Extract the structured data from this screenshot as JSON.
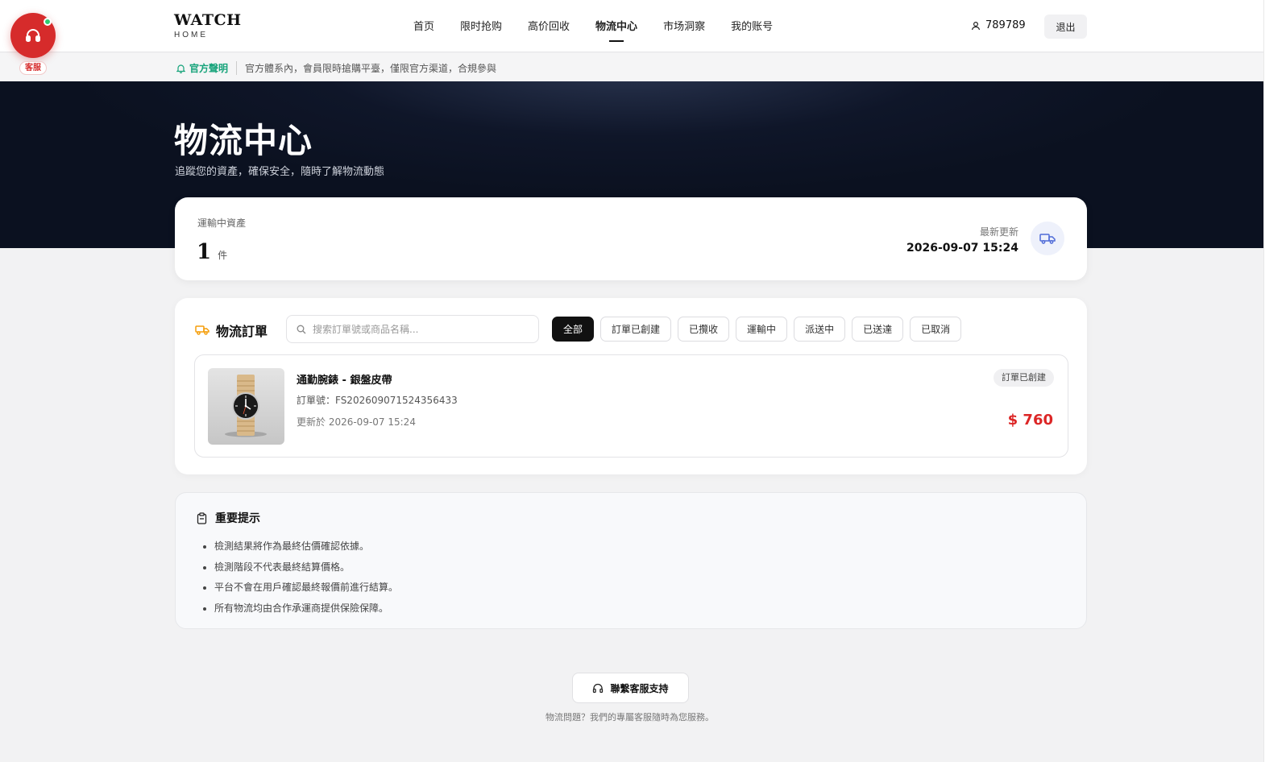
{
  "header": {
    "logo_main": "WATCH",
    "logo_sub": "HOME",
    "nav": [
      "首页",
      "限时抢购",
      "高价回收",
      "物流中心",
      "市场洞察",
      "我的账号"
    ],
    "username": "789789",
    "logout_label": "退出"
  },
  "notice": {
    "tag": "官方聲明",
    "text": "官方體系內，會員限時搶購平臺，僅限官方渠道，合規參與"
  },
  "support_fab": {
    "label": "客服",
    "accent": "#d62b2b"
  },
  "hero": {
    "title": "物流中心",
    "subtitle": "追蹤您的資產，確保安全，隨時了解物流動態"
  },
  "summary": {
    "in_transit_label": "運輸中資產",
    "count": "1",
    "unit": "件",
    "updated_label": "最新更新",
    "updated_time": "2026-09-07 15:24"
  },
  "orders": {
    "title": "物流訂單",
    "search_placeholder": "搜索訂單號或商品名稱...",
    "filters": [
      "全部",
      "訂單已創建",
      "已攬收",
      "運輸中",
      "派送中",
      "已送達",
      "已取消"
    ],
    "active_filter": "全部",
    "items": [
      {
        "name": "通勤腕錶 - 銀盤皮帶",
        "order_no": "訂單號：FS202609071524356433",
        "updated": "更新於 2026-09-07 15:24",
        "status": "訂單已創建",
        "price": "$ 760"
      }
    ]
  },
  "tips": {
    "title": "重要提示",
    "items": [
      "檢測結果將作為最終估價確認依據。",
      "檢測階段不代表最終結算價格。",
      "平台不會在用戶確認最終報價前進行結算。",
      "所有物流均由合作承運商提供保險保障。"
    ]
  },
  "footer": {
    "support_label": "聯繫客服支持",
    "note": "物流問題？我們的專屬客服隨時為您服務。"
  },
  "colors": {
    "accent_green": "#16a37a",
    "price_red": "#dc2626",
    "truck_orange": "#f59e0b",
    "truck_blue": "#4f6bd8"
  }
}
